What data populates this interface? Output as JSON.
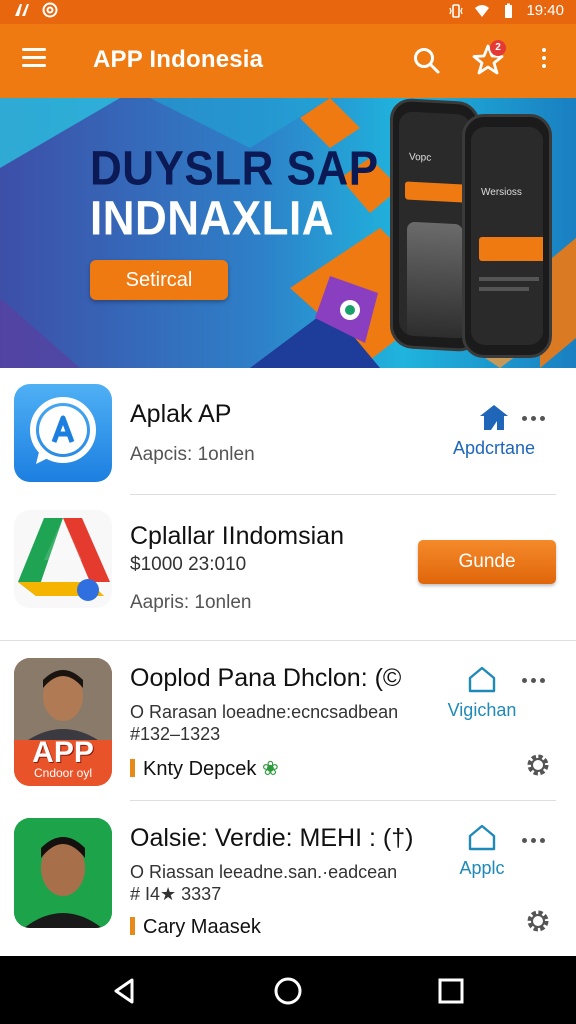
{
  "status_bar": {
    "time": "19:40"
  },
  "app_bar": {
    "title": "APP Indonesia",
    "notification_count": "2"
  },
  "banner": {
    "headline_line1": "DUYSLR SAP",
    "headline_line2": "INDNAXLIA",
    "cta_label": "Setircal",
    "phone_left": {
      "text": "Vopc"
    },
    "phone_right": {
      "text": "Wersioss"
    }
  },
  "apps": [
    {
      "name": "Aplak AP",
      "subtitle": "Aapcis: 1onlen",
      "action_label": "Apdcrtane"
    },
    {
      "name": "Cplallar IIndomsian",
      "price": "$1000 23:010",
      "subtitle": "Aapris: 1onlen",
      "button_label": "Gunde"
    },
    {
      "name": "Ooplod Pana Dhclon: (©",
      "line1": "O Rarasan loeadne:ecncsadbean",
      "line2": "#132–1323",
      "tag": "Knty Depcek",
      "action_label": "Vigichan",
      "icon_caption_big": "APP",
      "icon_caption_small": "Cndoor oyl"
    },
    {
      "name": "Oalsie: Verdie: MEHI : (†)",
      "line1": "O Riassan leeadne.san.·eadcean",
      "line2": "# I4★ 3337",
      "tag": "Cary Maasek",
      "action_label": "Applc"
    }
  ],
  "colors": {
    "primary_orange": "#f07a12",
    "link_blue": "#1f66b8",
    "nav_black": "#000000"
  },
  "icons": [
    "menu-icon",
    "search-icon",
    "star-icon",
    "more-vert-icon",
    "house-icon",
    "more-horiz-icon",
    "gear-icon",
    "back-icon",
    "home-circle-icon",
    "recents-square-icon"
  ]
}
